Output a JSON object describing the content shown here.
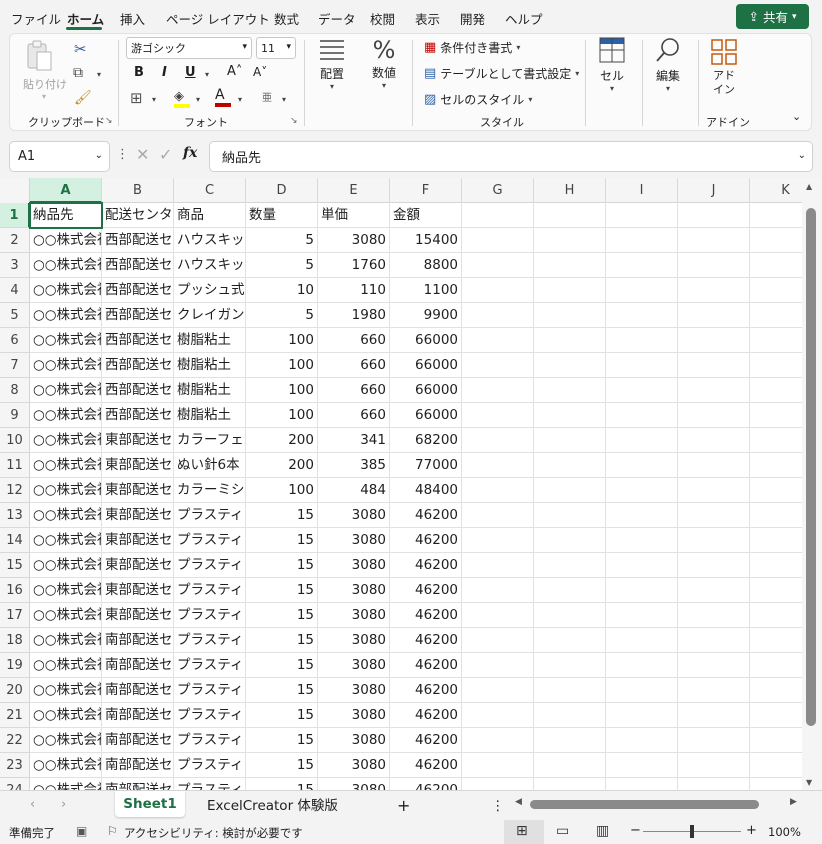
{
  "menu": {
    "items": [
      "ファイル",
      "ホーム",
      "挿入",
      "ページ レイアウト",
      "数式",
      "データ",
      "校閲",
      "表示",
      "開発",
      "ヘルプ"
    ],
    "active": "ホーム",
    "share_label": "共有"
  },
  "ribbon": {
    "clipboard": {
      "paste_label": "貼り付け",
      "group_label": "クリップボード"
    },
    "font": {
      "font_name": "游ゴシック",
      "font_size": "11",
      "group_label": "フォント"
    },
    "alignment": {
      "label": "配置"
    },
    "number": {
      "label": "数値"
    },
    "styles": {
      "conditional": "条件付き書式",
      "table": "テーブルとして書式設定",
      "cell_style": "セルのスタイル",
      "group_label": "スタイル"
    },
    "cells": {
      "label": "セル"
    },
    "editing": {
      "label": "編集"
    },
    "addins": {
      "label_line1": "アド",
      "label_line2": "イン",
      "group_label": "アドイン"
    },
    "colors": {
      "accent": "#1e7145",
      "font_color_bar": "#c00000",
      "highlight_bar": "#ffff00"
    }
  },
  "formula_bar": {
    "name_box": "A1",
    "fx_label": "fx",
    "content": "納品先"
  },
  "grid": {
    "columns": [
      "A",
      "B",
      "C",
      "D",
      "E",
      "F",
      "G",
      "H",
      "I",
      "J",
      "K"
    ],
    "selected_column": "A",
    "selected_row": "1",
    "rows": [
      {
        "n": "1",
        "cells": [
          "納品先",
          "配送センター",
          "商品",
          "数量",
          "単価",
          "金額"
        ],
        "header": true
      },
      {
        "n": "2",
        "cells": [
          "○○株式会社",
          "西部配送センター",
          "ハウスキット",
          "5",
          "3080",
          "15400"
        ]
      },
      {
        "n": "3",
        "cells": [
          "○○株式会社",
          "西部配送センター",
          "ハウスキット",
          "5",
          "1760",
          "8800"
        ]
      },
      {
        "n": "4",
        "cells": [
          "○○株式会社",
          "西部配送センター",
          "プッシュ式",
          "10",
          "110",
          "1100"
        ]
      },
      {
        "n": "5",
        "cells": [
          "○○株式会社",
          "西部配送センター",
          "クレイガン",
          "5",
          "1980",
          "9900"
        ]
      },
      {
        "n": "6",
        "cells": [
          "○○株式会社",
          "西部配送センター",
          "樹脂粘土",
          "100",
          "660",
          "66000"
        ]
      },
      {
        "n": "7",
        "cells": [
          "○○株式会社",
          "西部配送センター",
          "樹脂粘土",
          "100",
          "660",
          "66000"
        ]
      },
      {
        "n": "8",
        "cells": [
          "○○株式会社",
          "西部配送センター",
          "樹脂粘土",
          "100",
          "660",
          "66000"
        ]
      },
      {
        "n": "9",
        "cells": [
          "○○株式会社",
          "西部配送センター",
          "樹脂粘土",
          "100",
          "660",
          "66000"
        ]
      },
      {
        "n": "10",
        "cells": [
          "○○株式会社",
          "東部配送センター",
          "カラーフェルト",
          "200",
          "341",
          "68200"
        ]
      },
      {
        "n": "11",
        "cells": [
          "○○株式会社",
          "東部配送センター",
          "ぬい針6本",
          "200",
          "385",
          "77000"
        ]
      },
      {
        "n": "12",
        "cells": [
          "○○株式会社",
          "東部配送センター",
          "カラーミシン糸",
          "100",
          "484",
          "48400"
        ]
      },
      {
        "n": "13",
        "cells": [
          "○○株式会社",
          "東部配送センター",
          "プラスティック",
          "15",
          "3080",
          "46200"
        ]
      },
      {
        "n": "14",
        "cells": [
          "○○株式会社",
          "東部配送センター",
          "プラスティック",
          "15",
          "3080",
          "46200"
        ]
      },
      {
        "n": "15",
        "cells": [
          "○○株式会社",
          "東部配送センター",
          "プラスティック",
          "15",
          "3080",
          "46200"
        ]
      },
      {
        "n": "16",
        "cells": [
          "○○株式会社",
          "東部配送センター",
          "プラスティック",
          "15",
          "3080",
          "46200"
        ]
      },
      {
        "n": "17",
        "cells": [
          "○○株式会社",
          "東部配送センター",
          "プラスティック",
          "15",
          "3080",
          "46200"
        ]
      },
      {
        "n": "18",
        "cells": [
          "○○株式会社",
          "南部配送センター",
          "プラスティック",
          "15",
          "3080",
          "46200"
        ]
      },
      {
        "n": "19",
        "cells": [
          "○○株式会社",
          "南部配送センター",
          "プラスティック",
          "15",
          "3080",
          "46200"
        ]
      },
      {
        "n": "20",
        "cells": [
          "○○株式会社",
          "南部配送センター",
          "プラスティック",
          "15",
          "3080",
          "46200"
        ]
      },
      {
        "n": "21",
        "cells": [
          "○○株式会社",
          "南部配送センター",
          "プラスティック",
          "15",
          "3080",
          "46200"
        ]
      },
      {
        "n": "22",
        "cells": [
          "○○株式会社",
          "南部配送センター",
          "プラスティック",
          "15",
          "3080",
          "46200"
        ]
      },
      {
        "n": "23",
        "cells": [
          "○○株式会社",
          "南部配送センター",
          "プラスティック",
          "15",
          "3080",
          "46200"
        ]
      },
      {
        "n": "24",
        "cells": [
          "○○株式会社",
          "南部配送センター",
          "プラスティック",
          "15",
          "3080",
          "46200"
        ]
      }
    ]
  },
  "sheet_tabs": {
    "active": "Sheet1",
    "other": "ExcelCreator 体験版",
    "add_label": "+",
    "more_label": "⋮"
  },
  "status": {
    "ready": "準備完了",
    "accessibility": "アクセシビリティ: 検討が必要です",
    "zoom": "100%"
  }
}
